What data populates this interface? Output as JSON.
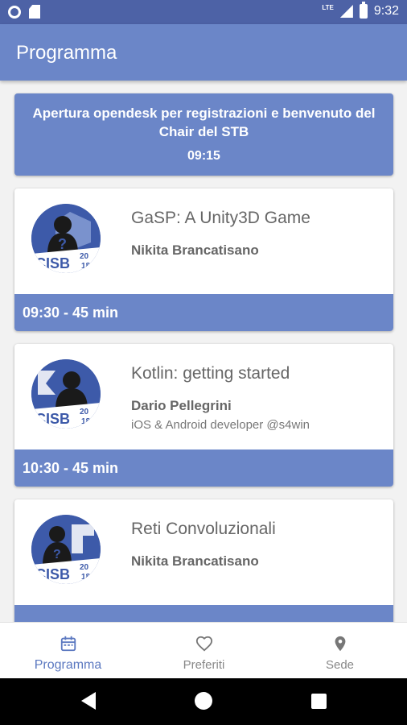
{
  "status_bar": {
    "network": "LTE",
    "time": "9:32"
  },
  "app_bar": {
    "title": "Programma"
  },
  "opening": {
    "title": "Apertura opendesk per registrazioni e benvenuto del Chair del STB",
    "time": "09:15"
  },
  "talks": [
    {
      "title": "GaSP: A Unity3D Game",
      "speaker": "Nikita Brancatisano",
      "role": "",
      "footer": "09:30 - 45 min",
      "logo_text": "CISB",
      "logo_year_top": "20",
      "logo_year_bottom": "18"
    },
    {
      "title": "Kotlin: getting started",
      "speaker": "Dario Pellegrini",
      "role": "iOS & Android developer @s4win",
      "footer": "10:30 - 45 min",
      "logo_text": "CISB",
      "logo_year_top": "20",
      "logo_year_bottom": "18"
    },
    {
      "title": "Reti Convoluzionali",
      "speaker": "Nikita Brancatisano",
      "role": "",
      "footer": "",
      "logo_text": "CISB",
      "logo_year_top": "20",
      "logo_year_bottom": "18"
    }
  ],
  "bottom_nav": {
    "items": [
      {
        "label": "Programma",
        "icon": "calendar-icon",
        "active": true
      },
      {
        "label": "Preferiti",
        "icon": "heart-icon",
        "active": false
      },
      {
        "label": "Sede",
        "icon": "location-pin-icon",
        "active": false
      }
    ]
  },
  "colors": {
    "status_bar": "#4d62a6",
    "primary": "#6b86c8",
    "active_nav": "#5b78c0",
    "logo_blue": "#3d5aa9"
  }
}
